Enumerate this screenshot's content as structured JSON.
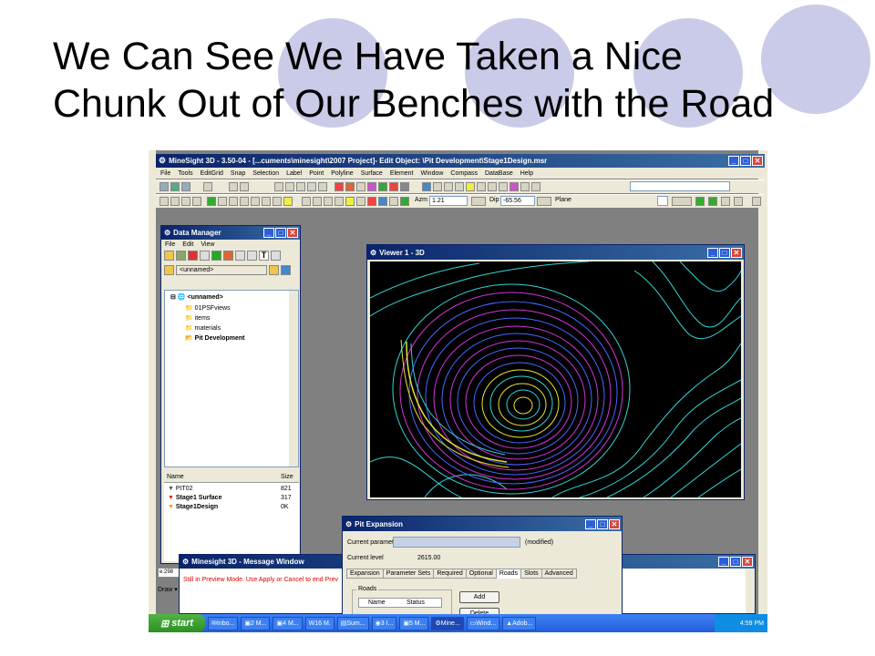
{
  "slide": {
    "title_line1": "We Can See We Have Taken a Nice",
    "title_line2": "Chunk Out of Our Benches with the Road"
  },
  "app": {
    "title": "MineSight 3D - 3.50-04 - [...cuments\\minesight\\2007 Project]- Edit Object: \\Pit Development\\Stage1Design.msr",
    "menu": [
      "File",
      "Tools",
      "EditGrid",
      "Snap",
      "Selection",
      "Label",
      "Point",
      "Polyline",
      "Surface",
      "Element",
      "Window",
      "Compass",
      "DataBase",
      "Help"
    ],
    "azm_label": "Azm",
    "azm_value": "1.21",
    "dip_label": "Dip",
    "dip_value": "-65.56",
    "plane_label": "Plane"
  },
  "data_manager": {
    "title": "Data Manager",
    "menu": [
      "File",
      "Edit",
      "View"
    ],
    "path_value": "<unnamed>",
    "tree": {
      "root": "<unnamed>",
      "items": [
        "01PSFviews",
        "items",
        "materials",
        "Pit Development"
      ]
    },
    "list_headers": {
      "name": "Name",
      "size": "Size"
    },
    "list_rows": [
      {
        "name": "PIT02",
        "size": "821"
      },
      {
        "name": "Stage1 Surface",
        "size": "317"
      },
      {
        "name": "Stage1Design",
        "size": "0K"
      }
    ]
  },
  "viewer": {
    "title": "Viewer 1 - 3D"
  },
  "pit_expansion": {
    "title": "Pit Expansion",
    "param_label": "Current parameter set",
    "param_status": "(modified)",
    "level_label": "Current level",
    "level_value": "2615.00",
    "tabs": [
      "Expansion",
      "Parameter Sets",
      "Required",
      "Optional",
      "Roads",
      "Slots",
      "Advanced"
    ],
    "active_tab": "Roads",
    "roads_group": "Roads",
    "roads_cols": [
      "Name",
      "Status"
    ],
    "add_label": "Add",
    "delete_label": "Delete"
  },
  "message_window": {
    "title": "Minesight 3D - Message Window",
    "text": "Still in Preview Mode. Use Apply or Cancel to end Prev"
  },
  "side": {
    "draw_label": "Draw",
    "coord_fragment": "e:298"
  },
  "taskbar": {
    "start_label": "start",
    "tasks": [
      "Inbo...",
      "2 M...",
      "4 M...",
      "16 M.",
      "Sum...",
      "3 I...",
      "5 M...",
      "Mine...",
      "Wind...",
      "Adob..."
    ],
    "clock": "4:59 PM"
  },
  "colors": {
    "titlebar": "#0a246a",
    "contour_cyan": "#33d6d6",
    "contour_magenta": "#d633d6",
    "contour_blue": "#4d66ff",
    "contour_yellow": "#e6e633"
  }
}
